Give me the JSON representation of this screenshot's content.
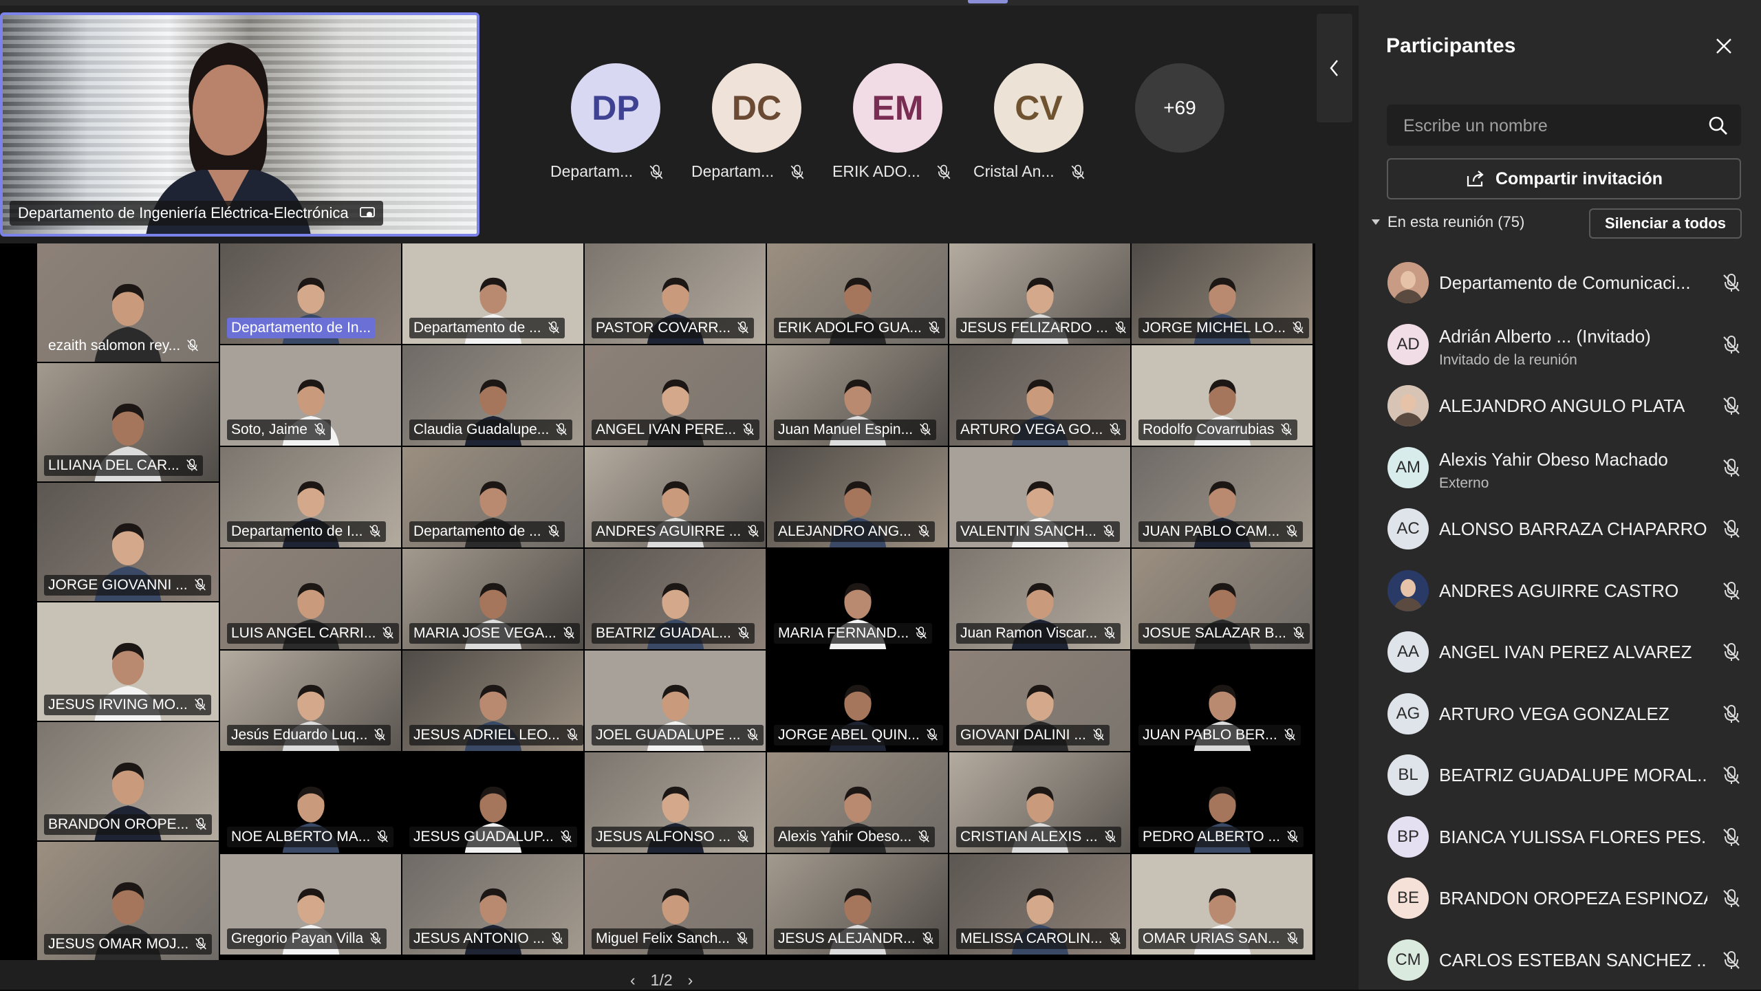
{
  "presenter": {
    "name": "Departamento de Ingeniería Eléctrica-Electrónica"
  },
  "strip": [
    {
      "initials": "DP",
      "label": "Departam...",
      "bg": "#d9d8f2",
      "fg": "#3f4292"
    },
    {
      "initials": "DC",
      "label": "Departam...",
      "bg": "#efe2d9",
      "fg": "#6b4a33"
    },
    {
      "initials": "EM",
      "label": "ERIK ADO...",
      "bg": "#f1dbe4",
      "fg": "#7a2d52"
    },
    {
      "initials": "CV",
      "label": "Cristal An...",
      "bg": "#ece2d6",
      "fg": "#6f5331"
    },
    {
      "initials": "+69",
      "label": "",
      "bg": "#3b3b3b",
      "fg": "#ffffff"
    }
  ],
  "grid": {
    "left_column": [
      "ezaith salomon rey...",
      "LILIANA DEL CAR...",
      "JORGE GIOVANNI ...",
      "JESUS IRVING MO...",
      "BRANDON OROPE...",
      "JESUS OMAR MOJ..."
    ],
    "rows": [
      [
        "Departamento de In...",
        "Departamento de ...",
        "PASTOR COVARR...",
        "ERIK ADOLFO GUA...",
        "JESUS FELIZARDO ...",
        "JORGE MICHEL LO..."
      ],
      [
        "Soto, Jaime",
        "Claudia Guadalupe...",
        "ANGEL IVAN PERE...",
        "Juan Manuel Espin...",
        "ARTURO VEGA GO...",
        "Rodolfo Covarrubias"
      ],
      [
        "Departamento de I...",
        "Departamento de ...",
        "ANDRES AGUIRRE ...",
        "ALEJANDRO ANG...",
        "VALENTIN SANCH...",
        "JUAN PABLO CAM..."
      ],
      [
        "LUIS ANGEL CARRI...",
        "MARIA JOSE VEGA...",
        "BEATRIZ GUADAL...",
        "MARIA FERNAND...",
        "Juan Ramon Viscar...",
        "JOSUE SALAZAR B..."
      ],
      [
        "Jesús Eduardo Luq...",
        "JESUS ADRIEL LEO...",
        "JOEL GUADALUPE ...",
        "JORGE ABEL QUIN...",
        "GIOVANI DALINI ...",
        "JUAN PABLO BER..."
      ],
      [
        "NOE ALBERTO MA...",
        "JESUS GUADALUP...",
        "JESUS ALFONSO ...",
        "Alexis Yahir Obeso...",
        "CRISTIAN ALEXIS ...",
        "PEDRO ALBERTO ..."
      ],
      [
        "Gregorio Payan Villa",
        "JESUS ANTONIO ...",
        "Miguel Felix Sanch...",
        "JESUS ALEJANDR...",
        "MELISSA CAROLIN...",
        "OMAR URIAS SAN..."
      ]
    ]
  },
  "pager": {
    "text": "1/2"
  },
  "panel": {
    "title": "Participantes",
    "search_placeholder": "Escribe un nombre",
    "share_label": "Compartir invitación",
    "section_label": "En esta reunión (75)",
    "mute_all_label": "Silenciar a todos",
    "participants": [
      {
        "initials": "",
        "name": "Departamento de Comunicaci...",
        "sub": "",
        "photo": true,
        "bg": "#c79b84"
      },
      {
        "initials": "AD",
        "name": "Adrián Alberto ...  (Invitado)",
        "sub": "Invitado de la reunión",
        "photo": false,
        "bg": "#f0dde6"
      },
      {
        "initials": "",
        "name": "ALEJANDRO ANGULO PLATA",
        "sub": "",
        "photo": true,
        "bg": "#d8c4b4"
      },
      {
        "initials": "AM",
        "name": "Alexis Yahir Obeso Machado",
        "sub": "Externo",
        "photo": false,
        "bg": "#d9ecec"
      },
      {
        "initials": "AC",
        "name": "ALONSO BARRAZA CHAPARRO",
        "sub": "",
        "photo": false,
        "bg": "#dfe4ea"
      },
      {
        "initials": "",
        "name": "ANDRES AGUIRRE CASTRO",
        "sub": "",
        "photo": true,
        "bg": "#2a3a66"
      },
      {
        "initials": "AA",
        "name": "ANGEL IVAN PEREZ ALVAREZ",
        "sub": "",
        "photo": false,
        "bg": "#dfe4ea"
      },
      {
        "initials": "AG",
        "name": "ARTURO VEGA GONZALEZ",
        "sub": "",
        "photo": false,
        "bg": "#dfe4ea"
      },
      {
        "initials": "BL",
        "name": "BEATRIZ GUADALUPE MORAL...",
        "sub": "",
        "photo": false,
        "bg": "#dfe4ea"
      },
      {
        "initials": "BP",
        "name": "BIANCA YULISSA FLORES PES...",
        "sub": "",
        "photo": false,
        "bg": "#e4e0f2"
      },
      {
        "initials": "BE",
        "name": "BRANDON OROPEZA ESPINOZA",
        "sub": "",
        "photo": false,
        "bg": "#f6e1d9"
      },
      {
        "initials": "CM",
        "name": "CARLOS ESTEBAN SANCHEZ ...",
        "sub": "",
        "photo": false,
        "bg": "#dbeadf"
      }
    ]
  }
}
